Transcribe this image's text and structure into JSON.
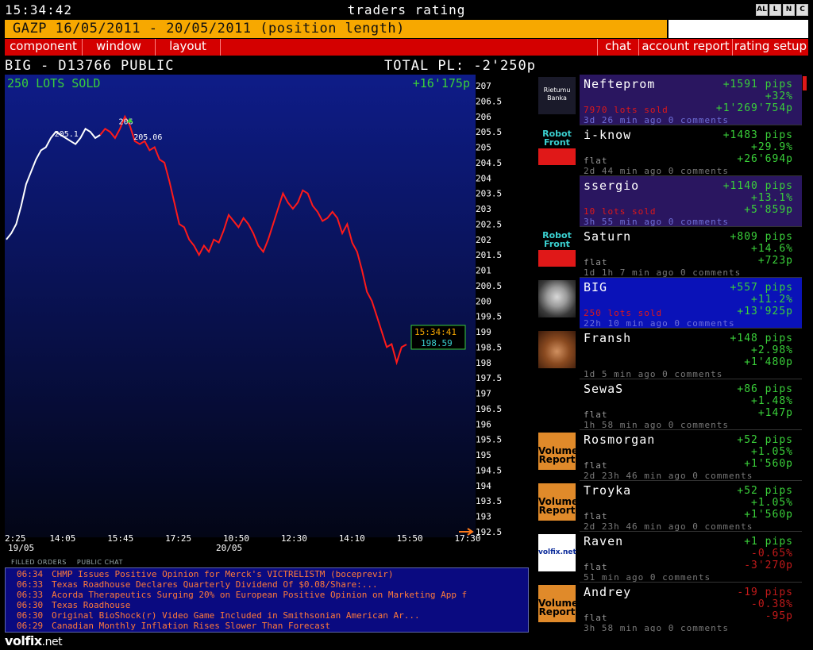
{
  "topbar": {
    "clock": "15:34:42",
    "title": "traders rating",
    "buttons": [
      "AL",
      "L",
      "N",
      "C"
    ]
  },
  "instrument": {
    "label": "GAZP 16/05/2011 - 20/05/2011 (position length)"
  },
  "menu": {
    "left": [
      "component",
      "window",
      "layout"
    ],
    "right": [
      "chat",
      "account report",
      "rating setup"
    ]
  },
  "board": {
    "title": "BIG - D13766 PUBLIC",
    "total_pl": "TOTAL PL: -2'250p"
  },
  "chart_data": {
    "type": "line",
    "position_label": "250 LOTS SOLD",
    "position_pl": "+16'175p",
    "current_time": "15:34:41",
    "current_price": "198.59",
    "price_annotations": [
      "205.1",
      "206",
      "205.06"
    ],
    "y_ticks": [
      "207",
      "206.5",
      "206",
      "205.5",
      "205",
      "204.5",
      "204",
      "203.5",
      "203",
      "202.5",
      "202",
      "201.5",
      "201",
      "200.5",
      "200",
      "199.5",
      "199",
      "198.5",
      "198",
      "197.5",
      "197",
      "196.5",
      "196",
      "195.5",
      "195",
      "194.5",
      "194",
      "193.5",
      "193",
      "192.5"
    ],
    "ylim": [
      192.5,
      207
    ],
    "x_ticks": [
      "2:25",
      "14:05",
      "15:45",
      "17:25",
      "10:50",
      "12:30",
      "14:10",
      "15:50",
      "17:30"
    ],
    "date_labels": [
      "19/05",
      "20/05"
    ],
    "colors": {
      "before_entry": "#ffffff",
      "after_entry": "#ff1a1a",
      "marker": "#3ad03a"
    },
    "series": [
      {
        "values": [
          202.0,
          202.2,
          202.5,
          203.1,
          203.8,
          204.2,
          204.6,
          204.9,
          205.0,
          205.3,
          205.5,
          205.4,
          205.3,
          205.2,
          205.1,
          205.3,
          205.6,
          205.5,
          205.3,
          205.4
        ]
      },
      {
        "values": [
          205.4,
          205.6,
          205.5,
          205.3,
          205.6,
          206.0,
          205.7,
          205.2,
          205.1,
          205.2,
          204.9,
          205.0,
          204.6,
          204.5,
          203.9,
          203.2,
          202.5,
          202.4,
          202.0,
          201.8,
          201.5,
          201.8,
          201.6,
          202.0,
          201.9,
          202.3,
          202.8,
          202.6,
          202.4,
          202.7,
          202.5,
          202.2,
          201.8,
          201.6,
          202.0,
          202.5,
          203.0,
          203.5,
          203.2,
          203.0,
          203.2,
          203.6,
          203.5,
          203.1,
          202.9,
          202.6,
          202.7,
          202.9,
          202.7,
          202.2,
          202.5,
          201.9,
          201.6,
          201.0,
          200.3,
          200.0,
          199.5,
          199.0,
          198.5,
          198.6,
          198.0,
          198.5,
          198.59
        ]
      }
    ]
  },
  "tabs": [
    "FILLED ORDERS",
    "PUBLIC CHAT"
  ],
  "news": [
    {
      "time": "06:34",
      "text": "CHMP Issues Positive Opinion for Merck's VICTRELISTM (boceprevir)"
    },
    {
      "time": "06:33",
      "text": "Texas Roadhouse Declares Quarterly Dividend Of $0.08/Share:..."
    },
    {
      "time": "06:33",
      "text": "Acorda Therapeutics Surging 20% on European Positive Opinion on Marketing App f"
    },
    {
      "time": "06:30",
      "text": "Texas Roadhouse"
    },
    {
      "time": "06:30",
      "text": "Original BioShock(r) Video Game Included in Smithsonian American Ar..."
    },
    {
      "time": "06:29",
      "text": "Canadian Monthly Inflation Rises Slower Than Forecast"
    }
  ],
  "logo": {
    "main": "volfix",
    "suffix": ".net"
  },
  "traders": [
    {
      "name": "Neftеprom",
      "avatar": "rietumu-banka-logo",
      "avatar_text": "Rietumu Banka",
      "pips": "+1591 pips",
      "pct": "+32%",
      "pl": "+1'269'754p",
      "position": "7970 lots sold",
      "meta": "3d 26 min ago  0 comments",
      "style": "purple",
      "neg": false
    },
    {
      "name": "i-know",
      "avatar": "robot-front-logo",
      "avatar_text": "Robot Front",
      "pips": "+1483 pips",
      "pct": "+29.9%",
      "pl": "+26'694p",
      "position": "flat",
      "meta": "2d 44 min ago  0 comments",
      "style": "none",
      "neg": false
    },
    {
      "name": "ssergio",
      "avatar": "",
      "avatar_text": "",
      "pips": "+1140 pips",
      "pct": "+13.1%",
      "pl": "+5'859p",
      "position": "10 lots sold",
      "meta": "3h 55 min ago  0 comments",
      "style": "purple",
      "neg": false
    },
    {
      "name": "Saturn",
      "avatar": "robot-front-logo",
      "avatar_text": "Robot Front",
      "pips": "+809 pips",
      "pct": "+14.6%",
      "pl": "+723p",
      "position": "flat",
      "meta": "1d 1h 7 min ago  0 comments",
      "style": "none",
      "neg": false
    },
    {
      "name": "BIG",
      "avatar": "einstein-photo",
      "avatar_text": "",
      "pips": "+557 pips",
      "pct": "+11.2%",
      "pl": "+13'925p",
      "position": "250 lots sold",
      "meta": "22h 10 min ago  0 comments",
      "style": "blue",
      "neg": false
    },
    {
      "name": "Fransh",
      "avatar": "user-photo",
      "avatar_text": "",
      "pips": "+148 pips",
      "pct": "+2.98%",
      "pl": "+1'480p",
      "position": "",
      "meta": "1d 5 min ago  0 comments",
      "style": "none",
      "neg": false
    },
    {
      "name": "SewaS",
      "avatar": "",
      "avatar_text": "",
      "pips": "+86 pips",
      "pct": "+1.48%",
      "pl": "+147p",
      "position": "flat",
      "meta": "1h 58 min ago  0 comments",
      "style": "none",
      "neg": false
    },
    {
      "name": "Rosmorgan",
      "avatar": "volume-report-logo",
      "avatar_text": "Volume Report",
      "pips": "+52 pips",
      "pct": "+1.05%",
      "pl": "+1'560p",
      "position": "flat",
      "meta": "2d 23h 46 min ago  0 comments",
      "style": "none",
      "neg": false
    },
    {
      "name": "Troyka",
      "avatar": "volume-report-logo",
      "avatar_text": "Volume Report",
      "pips": "+52 pips",
      "pct": "+1.05%",
      "pl": "+1'560p",
      "position": "flat",
      "meta": "2d 23h 46 min ago  0 comments",
      "style": "none",
      "neg": false
    },
    {
      "name": "Raven",
      "avatar": "volfix-logo",
      "avatar_text": "volfix.net",
      "pips": "+1 pips",
      "pct": "-0.65%",
      "pl": "-3'270p",
      "position": "flat",
      "meta": "51 min ago  0 comments",
      "style": "none",
      "neg": true
    },
    {
      "name": "Andrey",
      "avatar": "volume-report-logo",
      "avatar_text": "Volume Report",
      "pips": "-19 pips",
      "pct": "-0.38%",
      "pl": "-95p",
      "position": "flat",
      "meta": "3h 58 min ago  0 comments",
      "style": "none",
      "neg": true
    }
  ]
}
